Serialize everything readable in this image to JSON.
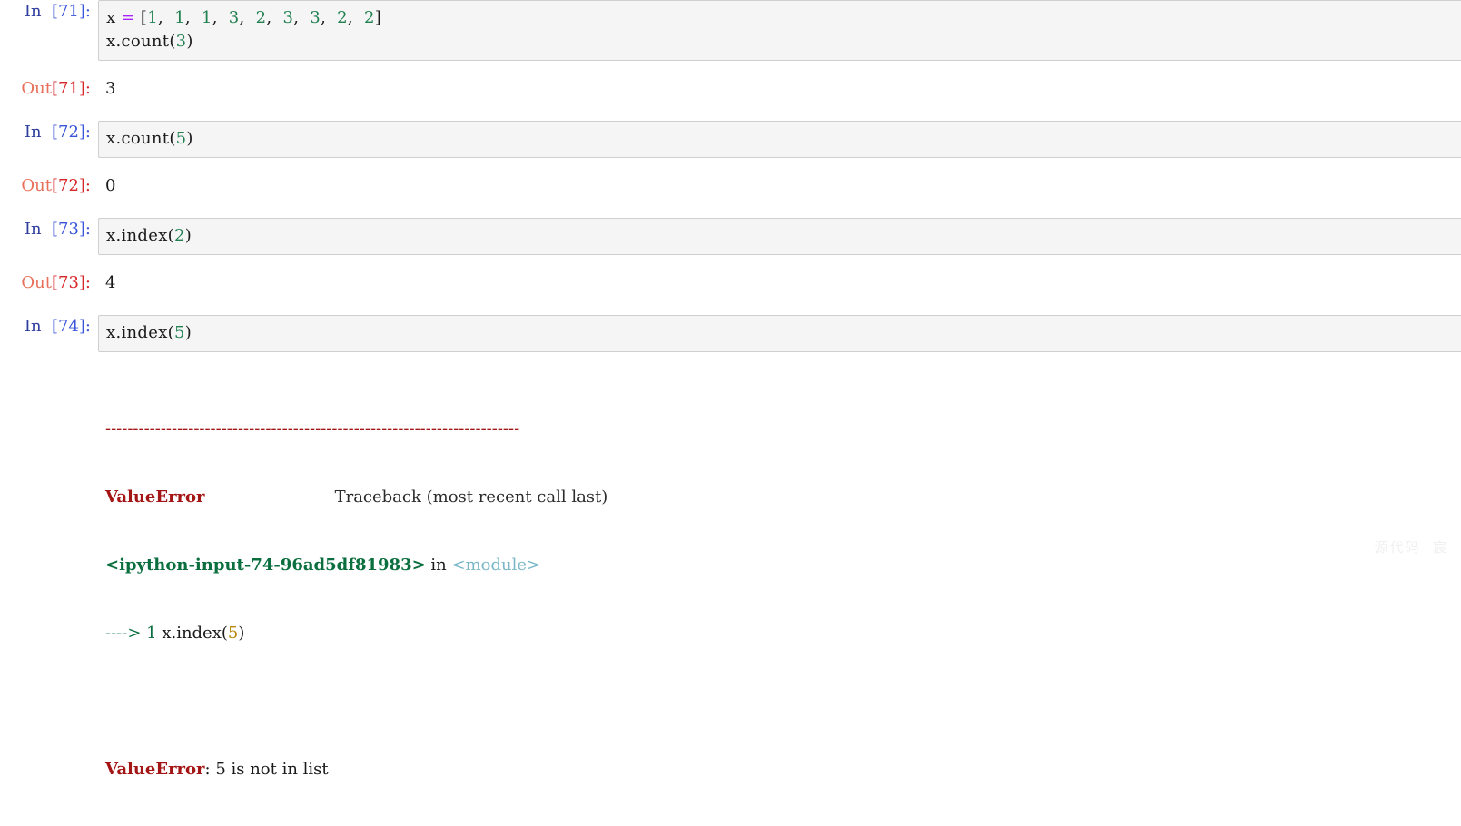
{
  "app": {
    "kind": "jupyter-ipython-notebook",
    "watermark": "源代码  宸"
  },
  "colors": {
    "cell_background": "#f5f5f5",
    "cell_border": "#cfcfcf",
    "prompt_in": "#303f9f",
    "prompt_in_number": "#3a55d9",
    "prompt_out": "#e8705a",
    "prompt_out_number": "#d62728",
    "syntax_operator": "#aa22ff",
    "syntax_number": "#208050",
    "traceback_rule": "#a41515",
    "traceback_error": "#a41515",
    "traceback_file": "#0a6e3f",
    "traceback_module": "#79b7c7",
    "page_background": "#ffffff"
  },
  "cells": [
    {
      "id": "cell-71",
      "prompt_word": "In",
      "prompt_number": "[71]:",
      "source_lines": [
        {
          "parts": [
            {
              "t": "x ",
              "c": "plain"
            },
            {
              "t": "=",
              "c": "op"
            },
            {
              "t": " [",
              "c": "punct"
            },
            {
              "t": "1",
              "c": "num"
            },
            {
              "t": ",  ",
              "c": "punct"
            },
            {
              "t": "1",
              "c": "num"
            },
            {
              "t": ",  ",
              "c": "punct"
            },
            {
              "t": "1",
              "c": "num"
            },
            {
              "t": ",  ",
              "c": "punct"
            },
            {
              "t": "3",
              "c": "num"
            },
            {
              "t": ",  ",
              "c": "punct"
            },
            {
              "t": "2",
              "c": "num"
            },
            {
              "t": ",  ",
              "c": "punct"
            },
            {
              "t": "3",
              "c": "num"
            },
            {
              "t": ",  ",
              "c": "punct"
            },
            {
              "t": "3",
              "c": "num"
            },
            {
              "t": ",  ",
              "c": "punct"
            },
            {
              "t": "2",
              "c": "num"
            },
            {
              "t": ",  ",
              "c": "punct"
            },
            {
              "t": "2",
              "c": "num"
            },
            {
              "t": "]",
              "c": "punct"
            }
          ]
        },
        {
          "parts": [
            {
              "t": "x.count",
              "c": "plain"
            },
            {
              "t": "(",
              "c": "punct"
            },
            {
              "t": "3",
              "c": "num"
            },
            {
              "t": ")",
              "c": "punct"
            }
          ]
        }
      ],
      "output": {
        "prompt_word": "Out",
        "prompt_number": "[71]:",
        "value": "3"
      }
    },
    {
      "id": "cell-72",
      "prompt_word": "In",
      "prompt_number": "[72]:",
      "source_lines": [
        {
          "parts": [
            {
              "t": "x.count",
              "c": "plain"
            },
            {
              "t": "(",
              "c": "punct"
            },
            {
              "t": "5",
              "c": "num"
            },
            {
              "t": ")",
              "c": "punct"
            }
          ]
        }
      ],
      "output": {
        "prompt_word": "Out",
        "prompt_number": "[72]:",
        "value": "0"
      }
    },
    {
      "id": "cell-73",
      "prompt_word": "In",
      "prompt_number": "[73]:",
      "source_lines": [
        {
          "parts": [
            {
              "t": "x.index",
              "c": "plain"
            },
            {
              "t": "(",
              "c": "punct"
            },
            {
              "t": "2",
              "c": "num"
            },
            {
              "t": ")",
              "c": "punct"
            }
          ]
        }
      ],
      "output": {
        "prompt_word": "Out",
        "prompt_number": "[73]:",
        "value": "4"
      }
    },
    {
      "id": "cell-74",
      "prompt_word": "In",
      "prompt_number": "[74]:",
      "source_lines": [
        {
          "parts": [
            {
              "t": "x.index",
              "c": "plain"
            },
            {
              "t": "(",
              "c": "punct"
            },
            {
              "t": "5",
              "c": "num"
            },
            {
              "t": ")",
              "c": "punct"
            }
          ]
        }
      ],
      "traceback": {
        "rule": "---------------------------------------------------------------------------",
        "error_name": "ValueError",
        "traceback_header": "Traceback (most recent call last)",
        "frame_file": "<ipython-input-74-96ad5df81983>",
        "frame_in": " in ",
        "frame_scope": "<module>",
        "arrow": "----> ",
        "line_number": "1",
        "line_code_prefix": " x.index",
        "line_code_open": "(",
        "line_code_arg": "5",
        "line_code_close": ")",
        "final_error_name": "ValueError",
        "final_error_message": ": 5 is not in list"
      }
    }
  ]
}
